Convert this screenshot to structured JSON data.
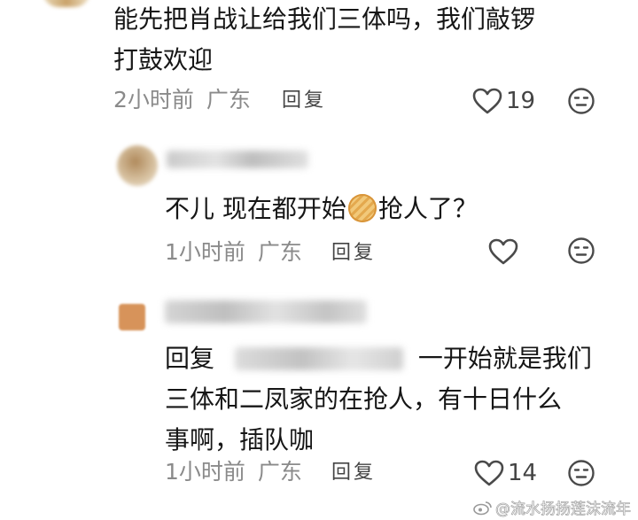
{
  "comments": [
    {
      "text_line1": "能先把肖战让给我们三体吗，我们敲锣",
      "text_line2": "打鼓欢迎",
      "time": "2小时前",
      "location": "广东",
      "reply_label": "回复",
      "likes": "19"
    },
    {
      "text_before": "不儿 现在都开始",
      "text_after": "抢人了？",
      "time": "1小时前",
      "location": "广东",
      "reply_label": "回复"
    },
    {
      "reply_prefix": "回复",
      "text_line1": "一开始就是我们",
      "text_line2": "三体和二凤家的在抢人，有十日什么",
      "text_line3": "事啊，插队咖",
      "time": "1小时前",
      "location": "广东",
      "reply_label": "回复",
      "likes": "14"
    }
  ],
  "watermark": "@流水扬扬莲沫流年",
  "colors": {
    "text": "#161616",
    "meta": "#8a8a8a",
    "icon": "#555555"
  },
  "icons": [
    "heart-icon",
    "meh-face-icon",
    "pancake-emoji-icon",
    "weibo-logo-icon"
  ]
}
